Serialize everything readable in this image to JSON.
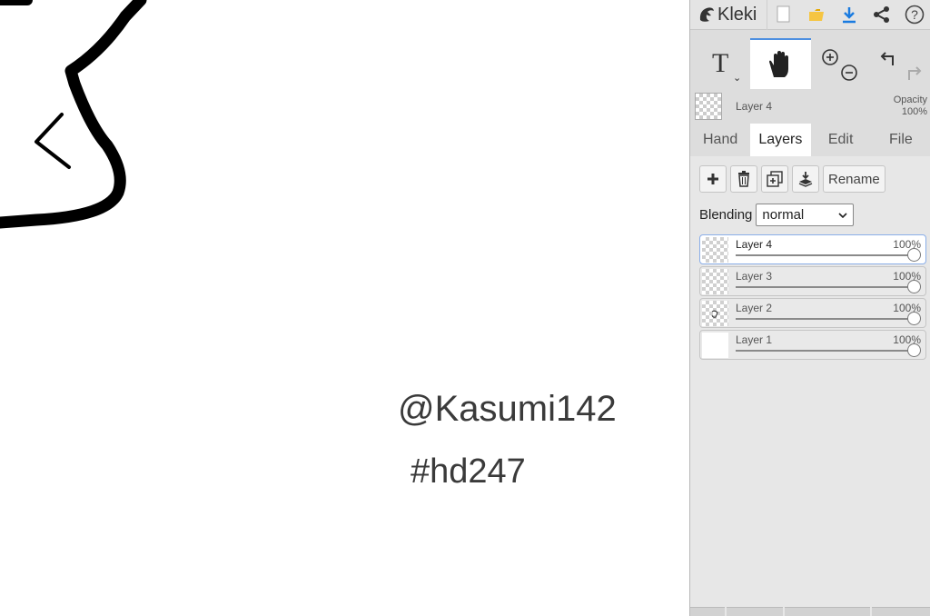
{
  "app": {
    "name": "Kleki"
  },
  "canvas": {
    "handle_text": "@Kasumi142",
    "tag_text": "#hd247"
  },
  "topbar": {
    "icons": [
      "new-image-icon",
      "open-folder-icon",
      "download-icon",
      "share-icon",
      "help-icon"
    ]
  },
  "tools": {
    "text_glyph": "T",
    "text_caret": "⌄",
    "active": "hand"
  },
  "current_layer": {
    "name": "Layer 4",
    "opacity_label": "Opacity",
    "opacity_value": "100%"
  },
  "tabs": [
    {
      "label": "Hand",
      "active": false
    },
    {
      "label": "Layers",
      "active": true
    },
    {
      "label": "Edit",
      "active": false
    },
    {
      "label": "File",
      "active": false
    }
  ],
  "layer_actions": {
    "rename_label": "Rename"
  },
  "blending": {
    "label": "Blending",
    "value": "normal"
  },
  "layers": [
    {
      "name": "Layer 4",
      "opacity": "100%",
      "opacity_fraction": 1.0,
      "selected": true
    },
    {
      "name": "Layer 3",
      "opacity": "100%",
      "opacity_fraction": 1.0,
      "selected": false
    },
    {
      "name": "Layer 2",
      "opacity": "100%",
      "opacity_fraction": 1.0,
      "selected": false
    },
    {
      "name": "Layer 1",
      "opacity": "100%",
      "opacity_fraction": 1.0,
      "selected": false
    }
  ],
  "colors": {
    "accent": "#4d8fe0",
    "panel_bg": "#dddddd",
    "canvas_bg": "#ffffff",
    "stroke": "#000000"
  }
}
